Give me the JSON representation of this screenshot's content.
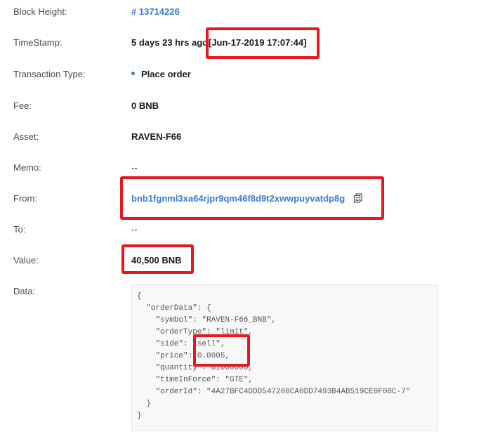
{
  "block_height": {
    "label": "Block Height:",
    "value": "# 13714226"
  },
  "timestamp": {
    "label": "TimeStamp:",
    "ago": "5 days 23 hrs ago",
    "exact": "[Jun-17-2019 17:07:44]"
  },
  "tx_type": {
    "label": "Transaction Type:",
    "value": "Place order"
  },
  "fee": {
    "label": "Fee:",
    "value": "0 BNB"
  },
  "asset": {
    "label": "Asset:",
    "value": "RAVEN-F66"
  },
  "memo": {
    "label": "Memo:",
    "value": "--"
  },
  "from": {
    "label": "From:",
    "value": "bnb1fgnml3xa64rjpr9qm46f8d9t2xwwpuyvatdp8g",
    "copy_icon": "copy-icon"
  },
  "to": {
    "label": "To:",
    "value": "--"
  },
  "value": {
    "label": "Value:",
    "value": "40,500 BNB"
  },
  "data": {
    "label": "Data:",
    "lines": [
      "{",
      "  \"orderData\": {",
      "    \"symbol\": \"RAVEN-F66_BNB\",",
      "    \"orderType\": \"limit\",",
      "    \"side\": \"sell\",",
      "    \"price\": 0.0005,",
      "    \"quantity\": 81000000,",
      "    \"timeInForce\": \"GTE\",",
      "    \"orderId\": \"4A27BFC4DDD547208CA0DD7493B4AB519CE0F08C-7\"",
      "  }",
      "}"
    ]
  },
  "colors": {
    "link": "#3a7bd5",
    "highlight": "#e8161d",
    "label": "#4a4a4a"
  }
}
